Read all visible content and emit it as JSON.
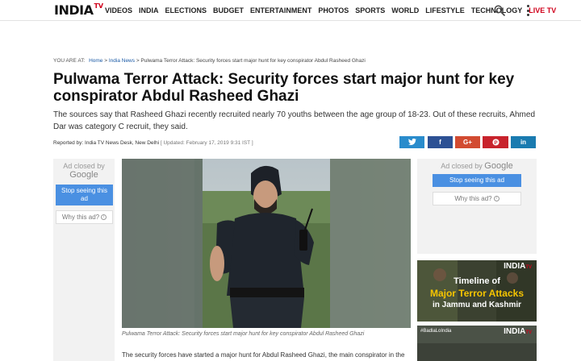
{
  "brand": {
    "india": "INDIA",
    "tv": "TV"
  },
  "nav": {
    "items": [
      "VIDEOS",
      "INDIA",
      "ELECTIONS",
      "BUDGET",
      "ENTERTAINMENT",
      "PHOTOS",
      "SPORTS",
      "WORLD",
      "LIFESTYLE",
      "TECHNOLOGY"
    ],
    "live": "LIVE TV",
    "icons": [
      "search-icon",
      "more-options-icon"
    ]
  },
  "breadcrumb": {
    "lead": "YOU ARE AT:",
    "home": "Home",
    "section": "India News",
    "current": "Pulwama Terror Attack: Security forces start major hunt for key conspirator Abdul Rasheed Ghazi"
  },
  "article": {
    "headline": "Pulwama Terror Attack: Security forces start major hunt for key conspirator Abdul Rasheed Ghazi",
    "summary": "The sources say that Rasheed Ghazi recently recruited nearly 70 youths between the age group of 18-23. Out of these recruits, Ahmed Dar was category C recruit, they said.",
    "reported_by": "Reported by: India TV News Desk, New Delhi",
    "updated": "[ Updated: February 17, 2019 9:31 IST ]",
    "caption": "Pulwama Terror Attack: Security forces start major hunt for key conspirator Abdul Rasheed Ghazi",
    "body_start": "The security forces have started a major hunt for Abdul Rasheed Ghazi, the main conspirator in the"
  },
  "share": {
    "twitter": "t",
    "facebook": "f",
    "google": "G+",
    "pinterest": "P",
    "linkedin": "in"
  },
  "ads": {
    "left": {
      "closed_by": "Ad closed by",
      "google": "Google",
      "stop": "Stop seeing this ad",
      "why": "Why this ad?"
    },
    "right": {
      "closed_by": "Ad closed by",
      "google": "Google",
      "stop": "Stop seeing this ad",
      "why": "Why this ad?"
    }
  },
  "promo": {
    "line1": "Timeline of",
    "line2": "Major Terror Attacks",
    "line3": "in Jammu and Kashmir",
    "logo": "INDIA",
    "logo_tv": "TV",
    "tag2": "#BadlaLoIndia",
    "logo2": "INDIA"
  },
  "colors": {
    "accent_red": "#d0021b",
    "link_blue": "#1a5aa6",
    "ad_blue": "#4a90e2"
  }
}
